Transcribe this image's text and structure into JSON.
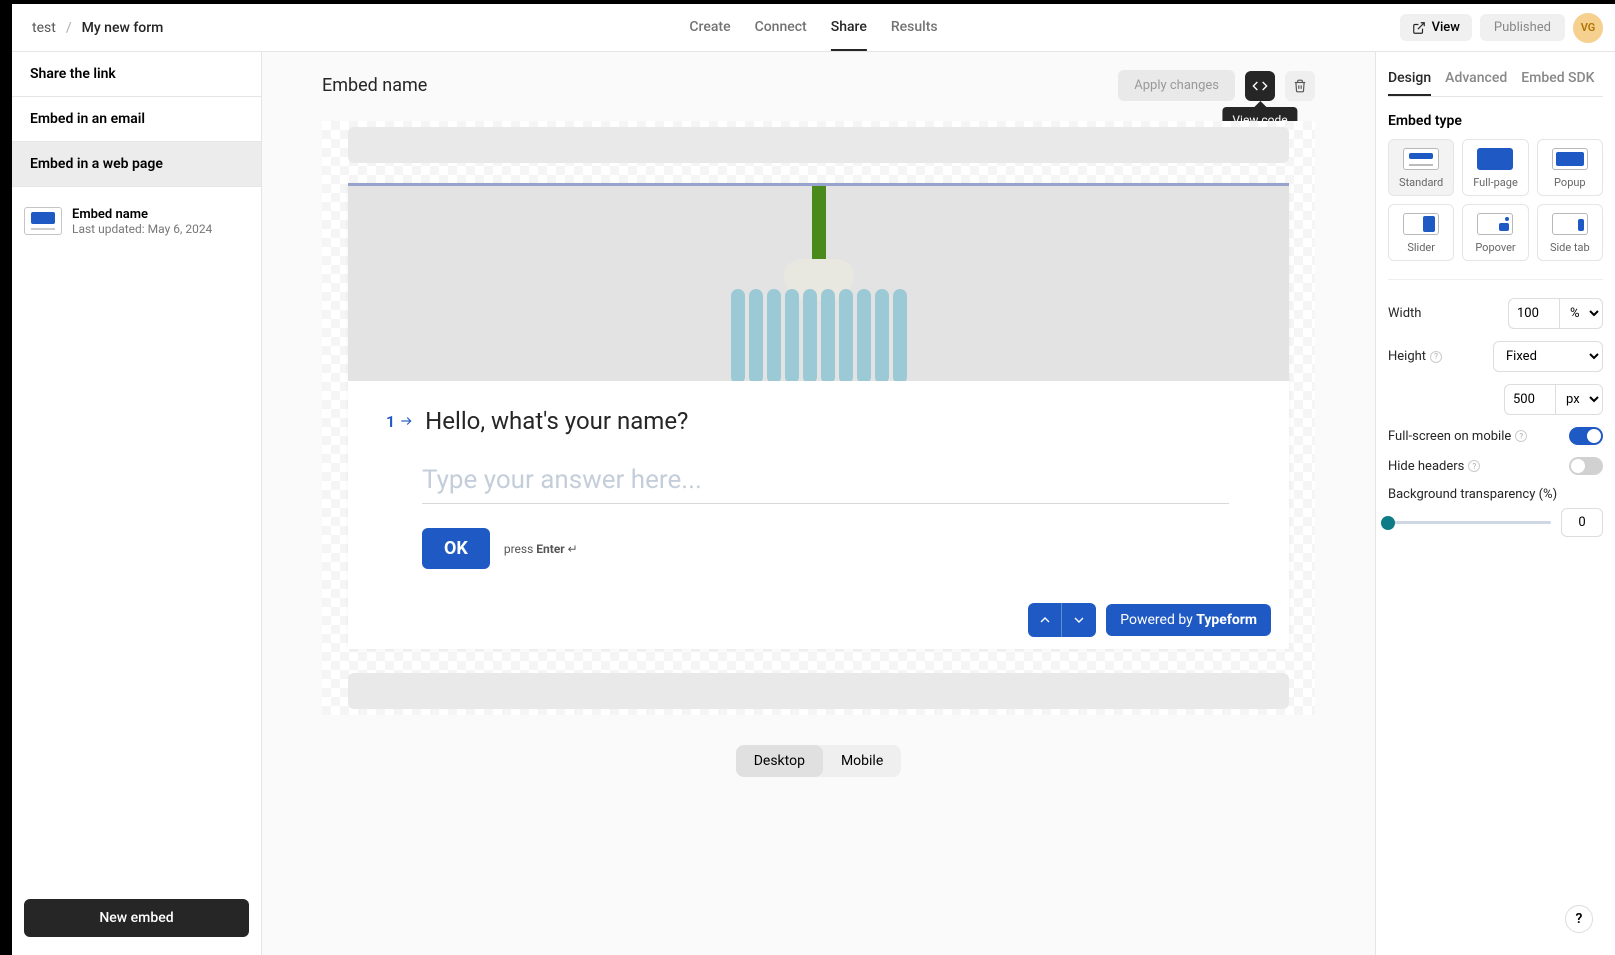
{
  "breadcrumb": {
    "workspace": "test",
    "form": "My new form"
  },
  "nav": {
    "create": "Create",
    "connect": "Connect",
    "share": "Share",
    "results": "Results"
  },
  "top": {
    "view": "View",
    "published": "Published",
    "avatar": "VG"
  },
  "sidebar": {
    "share_link": "Share the link",
    "email": "Embed in an email",
    "web": "Embed in a web page"
  },
  "embed_item": {
    "title": "Embed name",
    "subtitle": "Last updated: May 6, 2024"
  },
  "new_embed_button": "New embed",
  "main": {
    "title": "Embed name",
    "apply": "Apply changes",
    "view_code_tooltip": "View code"
  },
  "form_preview": {
    "question_number": "1",
    "question": "Hello, what's your name?",
    "placeholder": "Type your answer here...",
    "ok": "OK",
    "hint_press": "press ",
    "hint_key": "Enter",
    "hint_glyph": " ↵",
    "powered_pre": "Powered by ",
    "powered_brand": "Typeform"
  },
  "device": {
    "desktop": "Desktop",
    "mobile": "Mobile"
  },
  "right": {
    "tabs": {
      "design": "Design",
      "advanced": "Advanced",
      "sdk": "Embed SDK"
    },
    "embed_type_title": "Embed type",
    "types": {
      "standard": "Standard",
      "full": "Full-page",
      "popup": "Popup",
      "slider": "Slider",
      "popover": "Popover",
      "sidetab": "Side tab"
    },
    "width_label": "Width",
    "width_value": "100",
    "width_unit": "%",
    "height_label": "Height",
    "height_mode": "Fixed",
    "height_value": "500",
    "height_unit": "px",
    "fullscreen_label": "Full-screen on mobile",
    "hide_headers_label": "Hide headers",
    "bg_label": "Background transparency (%)",
    "bg_value": "0"
  }
}
